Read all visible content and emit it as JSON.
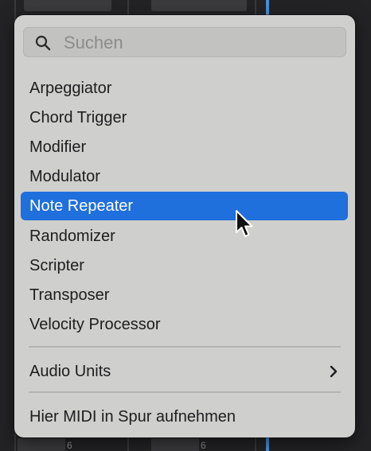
{
  "search": {
    "placeholder": "Suchen",
    "value": ""
  },
  "items": [
    {
      "label": "Arpeggiator"
    },
    {
      "label": "Chord Trigger"
    },
    {
      "label": "Modifier"
    },
    {
      "label": "Modulator"
    },
    {
      "label": "Note Repeater",
      "selected": true
    },
    {
      "label": "Randomizer"
    },
    {
      "label": "Scripter"
    },
    {
      "label": "Transposer"
    },
    {
      "label": "Velocity Processor"
    }
  ],
  "submenu": {
    "label": "Audio Units"
  },
  "action": {
    "label": "Hier MIDI in Spur aufnehmen"
  },
  "background": {
    "scale_left": "6",
    "scale_right": "6"
  },
  "colors": {
    "selection": "#1f6fdc",
    "menu_bg": "#cfcfcd",
    "accent_line": "#4a8fd8"
  },
  "icons": {
    "search": "search-icon",
    "submenu": "chevron-right-icon",
    "pointer": "mouse-pointer-icon"
  }
}
